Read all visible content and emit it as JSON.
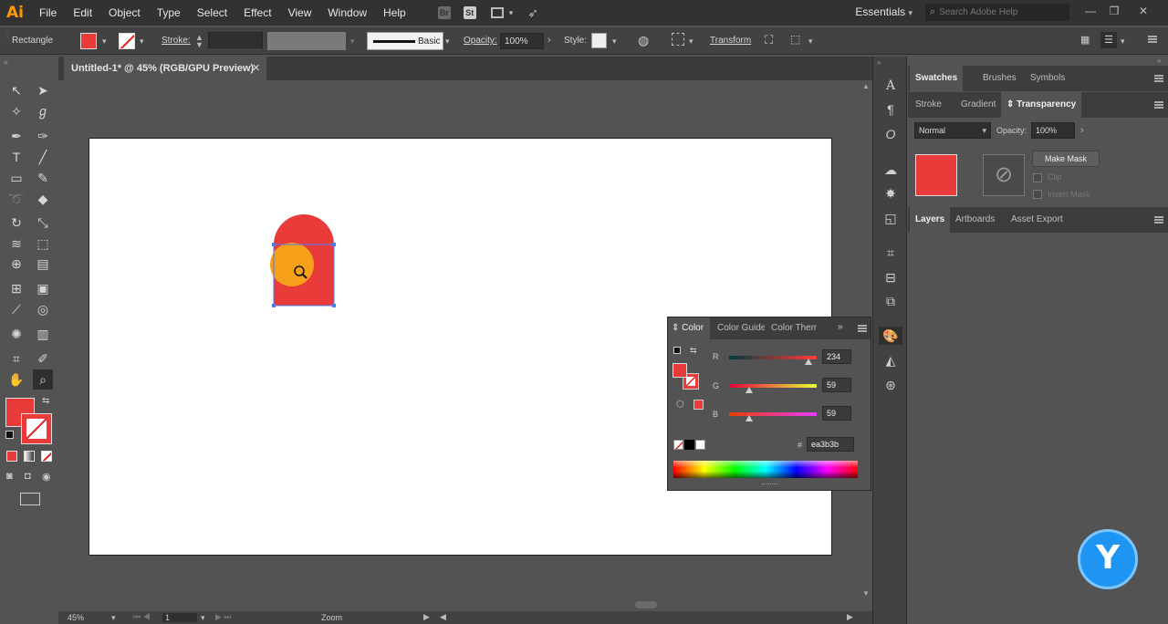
{
  "app": {
    "logo": "Ai"
  },
  "menu": [
    "File",
    "Edit",
    "Object",
    "Type",
    "Select",
    "Effect",
    "View",
    "Window",
    "Help"
  ],
  "menubar_icons": {
    "br": "Br",
    "st": "St"
  },
  "workspace": "Essentials",
  "search_placeholder": "Search Adobe Help",
  "control": {
    "selection": "Rectangle",
    "stroke_label": "Stroke:",
    "brush": "Basic",
    "opacity_label": "Opacity:",
    "opacity_value": "100%",
    "style_label": "Style:",
    "transform": "Transform"
  },
  "document": {
    "tab_title": "Untitled-1* @ 45% (RGB/GPU Preview)"
  },
  "panels": {
    "top_tabs": [
      "Swatches",
      "Brushes",
      "Symbols"
    ],
    "mid_tabs": [
      "Stroke",
      "Gradient",
      "Transparency"
    ],
    "blend_mode": "Normal",
    "opacity_label": "Opacity:",
    "opacity_value": "100%",
    "make_mask": "Make Mask",
    "clip": "Clip",
    "invert_mask": "Invert Mask",
    "bottom_tabs": [
      "Layers",
      "Artboards",
      "Asset Export"
    ]
  },
  "color_panel": {
    "tabs": [
      "Color",
      "Color Guide",
      "Color Themes"
    ],
    "r_label": "R",
    "r": "234",
    "g_label": "G",
    "g": "59",
    "b_label": "B",
    "b": "59",
    "hash": "#",
    "hex": "ea3b3b",
    "fill_color": "#ea3b3b"
  },
  "status": {
    "zoom": "45%",
    "page": "1",
    "tool": "Zoom"
  },
  "watermark": "Y"
}
